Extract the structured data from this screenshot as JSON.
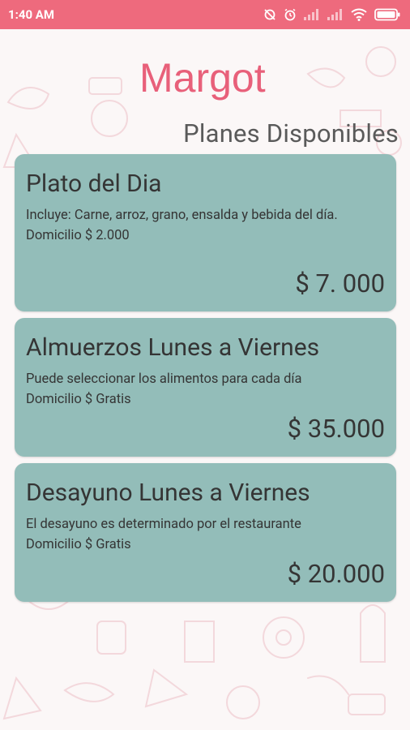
{
  "status_bar": {
    "time": "1:40 AM",
    "icons": [
      "mute-icon",
      "alarm-icon",
      "signal-icon",
      "signal-icon",
      "wifi-icon",
      "battery-icon"
    ]
  },
  "app": {
    "logo_text": "Margot",
    "title": "Planes Disponibles"
  },
  "plans": [
    {
      "title": "Plato del Dia",
      "description": "Incluye: Carne, arroz, grano, ensalda y bebida del día.",
      "delivery": "Domicilio $ 2.000",
      "price": "$ 7. 000"
    },
    {
      "title": "Almuerzos Lunes a Viernes",
      "description": "Puede seleccionar los alimentos para cada día",
      "delivery": "Domicilio $ Gratis",
      "price": "$ 35.000"
    },
    {
      "title": "Desayuno Lunes a Viernes",
      "description": "El desayuno es determinado por el restaurante",
      "delivery": "Domicilio $ Gratis",
      "price": "$ 20.000"
    }
  ],
  "colors": {
    "status_bar": "#ee6a7d",
    "card": "#93bdb9",
    "logo": "#e8607a",
    "background": "#fbf7f7"
  }
}
